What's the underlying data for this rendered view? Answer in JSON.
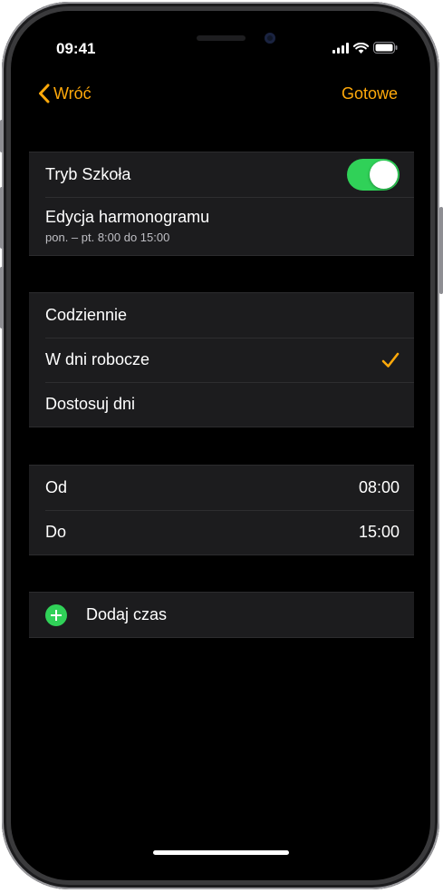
{
  "status_bar": {
    "time": "09:41",
    "icons": [
      "signal-icon",
      "wifi-icon",
      "battery-icon"
    ]
  },
  "nav": {
    "back_label": "Wróć",
    "done_label": "Gotowe"
  },
  "school_mode": {
    "toggle_label": "Tryb Szkoła",
    "toggle_on": true,
    "edit_schedule_label": "Edycja harmonogramu",
    "edit_schedule_subtitle": "pon. – pt. 8:00 do 15:00"
  },
  "days": {
    "options": [
      {
        "label": "Codziennie",
        "selected": false
      },
      {
        "label": "W dni robocze",
        "selected": true
      },
      {
        "label": "Dostosuj dni",
        "selected": false
      }
    ]
  },
  "time_range": {
    "from_label": "Od",
    "from_value": "08:00",
    "to_label": "Do",
    "to_value": "15:00"
  },
  "add_time": {
    "label": "Dodaj czas"
  },
  "colors": {
    "accent": "#ffa90a",
    "toggle_on": "#30d158",
    "add_button": "#30d158",
    "cell_background": "#1c1c1e",
    "background": "#000000"
  }
}
